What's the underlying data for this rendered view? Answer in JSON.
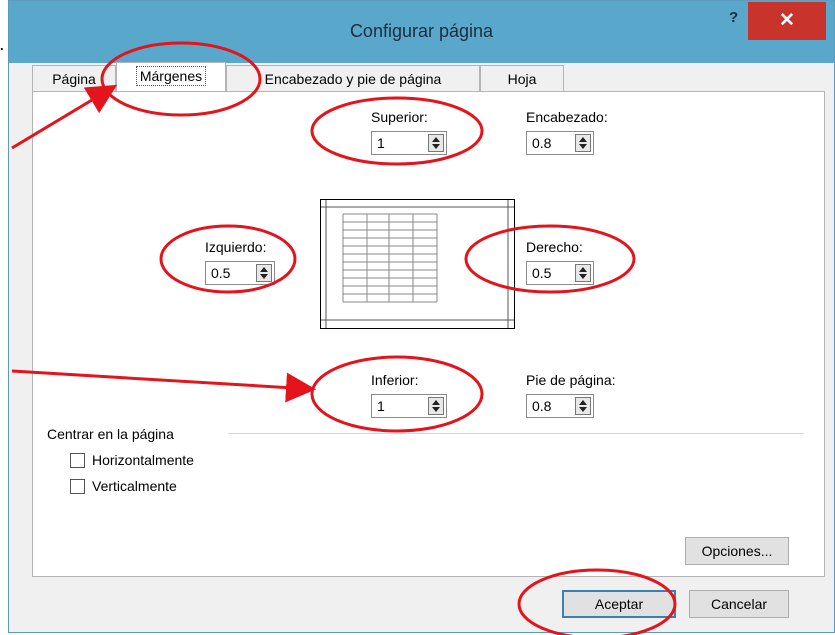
{
  "stray_dot": ".",
  "dialog": {
    "title": "Configurar página",
    "help": "?",
    "close": "✕"
  },
  "tabs": [
    "Página",
    "Márgenes",
    "Encabezado y pie de página",
    "Hoja"
  ],
  "active_tab": "Márgenes",
  "fields": {
    "superior": {
      "label": "Superior:",
      "value": "1"
    },
    "encabezado": {
      "label": "Encabezado:",
      "value": "0.8"
    },
    "izquierdo": {
      "label": "Izquierdo:",
      "value": "0.5"
    },
    "derecho": {
      "label": "Derecho:",
      "value": "0.5"
    },
    "inferior": {
      "label": "Inferior:",
      "value": "1"
    },
    "pie": {
      "label": "Pie de página:",
      "value": "0.8"
    }
  },
  "center": {
    "title": "Centrar en la página",
    "horizontal": "Horizontalmente",
    "vertical": "Verticalmente"
  },
  "buttons": {
    "opciones": "Opciones...",
    "aceptar": "Aceptar",
    "cancelar": "Cancelar"
  },
  "annotation_color": "#e3141b"
}
